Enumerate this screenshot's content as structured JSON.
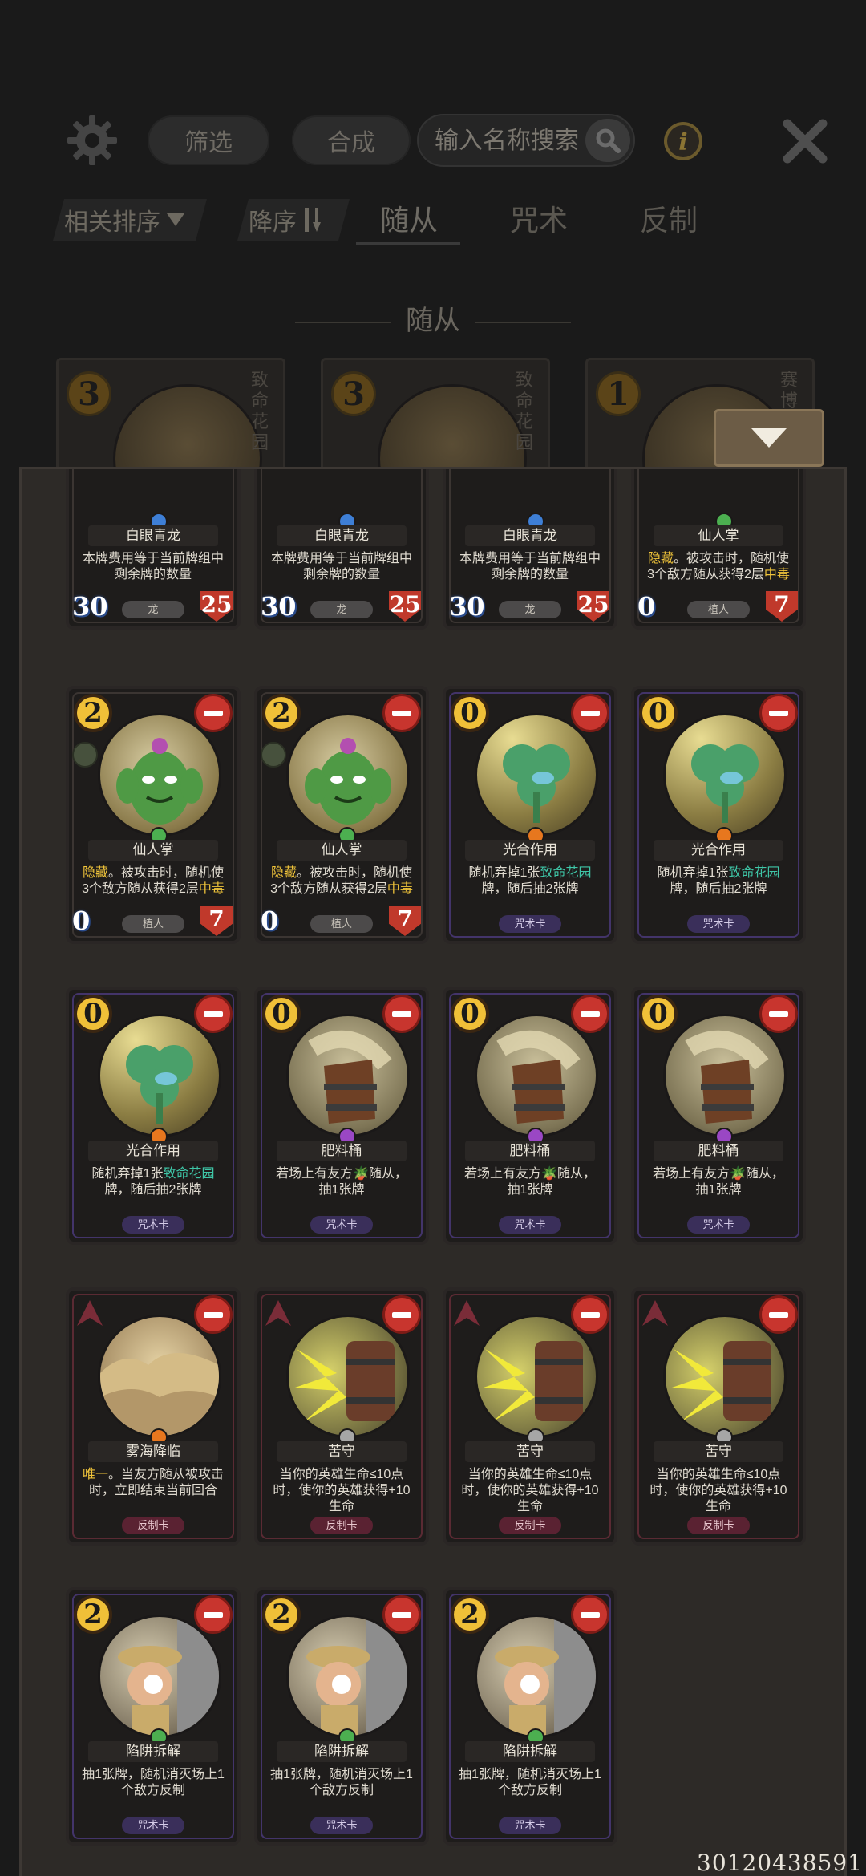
{
  "toolbar": {
    "filter_label": "筛选",
    "compose_label": "合成",
    "search_placeholder": "输入名称搜索"
  },
  "sortbar": {
    "relevance_label": "相关排序",
    "descending_label": "降序",
    "tabs": [
      {
        "label": "随从",
        "active": true
      },
      {
        "label": "咒术",
        "active": false
      },
      {
        "label": "反制",
        "active": false
      }
    ]
  },
  "section_title": "随从",
  "background_cards": [
    {
      "cost": "3",
      "tag": "致命花园"
    },
    {
      "cost": "3",
      "tag": "致命花园"
    },
    {
      "cost": "1",
      "tag": "赛博"
    }
  ],
  "cards": [
    {
      "name": "白眼青龙",
      "desc": [
        [
          "本牌费用等于当前牌组中剩余牌的数量",
          ""
        ]
      ],
      "atk": "30",
      "hp": "25",
      "tag": "龙",
      "gem": "blue",
      "type": "minion",
      "partial": true
    },
    {
      "name": "白眼青龙",
      "desc": [
        [
          "本牌费用等于当前牌组中剩余牌的数量",
          ""
        ]
      ],
      "atk": "30",
      "hp": "25",
      "tag": "龙",
      "gem": "blue",
      "type": "minion",
      "partial": true
    },
    {
      "name": "白眼青龙",
      "desc": [
        [
          "本牌费用等于当前牌组中剩余牌的数量",
          ""
        ]
      ],
      "atk": "30",
      "hp": "25",
      "tag": "龙",
      "gem": "blue",
      "type": "minion",
      "partial": true
    },
    {
      "name": "仙人掌",
      "desc": [
        [
          "隐藏",
          "kw"
        ],
        [
          "。被攻击时，随机使3个敌方随从获得2层",
          ""
        ],
        [
          "中毒",
          "kw"
        ]
      ],
      "atk": "0",
      "hp": "7",
      "tag": "植人",
      "gem": "green",
      "type": "minion",
      "partial": true
    },
    {
      "cost": "2",
      "name": "仙人掌",
      "desc": [
        [
          "隐藏",
          "kw"
        ],
        [
          "。被攻击时，随机使3个敌方随从获得2层",
          ""
        ],
        [
          "中毒",
          "kw"
        ]
      ],
      "atk": "0",
      "hp": "7",
      "tag": "植人",
      "gem": "green",
      "type": "minion",
      "art": "cactus"
    },
    {
      "cost": "2",
      "name": "仙人掌",
      "desc": [
        [
          "隐藏",
          "kw"
        ],
        [
          "。被攻击时，随机使3个敌方随从获得2层",
          ""
        ],
        [
          "中毒",
          "kw"
        ]
      ],
      "atk": "0",
      "hp": "7",
      "tag": "植人",
      "gem": "green",
      "type": "minion",
      "art": "cactus"
    },
    {
      "cost": "0",
      "name": "光合作用",
      "desc": [
        [
          "随机弃掉1张",
          ""
        ],
        [
          "致命花园",
          "kw-green"
        ],
        [
          "牌，随后抽2张牌",
          ""
        ]
      ],
      "tag": "咒术卡",
      "gem": "orange",
      "type": "spell",
      "art": "clover"
    },
    {
      "cost": "0",
      "name": "光合作用",
      "desc": [
        [
          "随机弃掉1张",
          ""
        ],
        [
          "致命花园",
          "kw-green"
        ],
        [
          "牌，随后抽2张牌",
          ""
        ]
      ],
      "tag": "咒术卡",
      "gem": "orange",
      "type": "spell",
      "art": "clover"
    },
    {
      "cost": "0",
      "name": "光合作用",
      "desc": [
        [
          "随机弃掉1张",
          ""
        ],
        [
          "致命花园",
          "kw-green"
        ],
        [
          "牌，随后抽2张牌",
          ""
        ]
      ],
      "tag": "咒术卡",
      "gem": "orange",
      "type": "spell",
      "art": "clover"
    },
    {
      "cost": "0",
      "name": "肥料桶",
      "desc": [
        [
          "若场上有友方",
          ""
        ],
        [
          "🪴",
          ""
        ],
        [
          "随从，抽1张牌",
          ""
        ]
      ],
      "tag": "咒术卡",
      "gem": "purple",
      "type": "spell",
      "art": "bucket"
    },
    {
      "cost": "0",
      "name": "肥料桶",
      "desc": [
        [
          "若场上有友方",
          ""
        ],
        [
          "🪴",
          ""
        ],
        [
          "随从，抽1张牌",
          ""
        ]
      ],
      "tag": "咒术卡",
      "gem": "purple",
      "type": "spell",
      "art": "bucket"
    },
    {
      "cost": "0",
      "name": "肥料桶",
      "desc": [
        [
          "若场上有友方",
          ""
        ],
        [
          "🪴",
          ""
        ],
        [
          "随从，抽1张牌",
          ""
        ]
      ],
      "tag": "咒术卡",
      "gem": "purple",
      "type": "spell",
      "art": "bucket"
    },
    {
      "name": "雾海降临",
      "desc": [
        [
          "唯一",
          "kw"
        ],
        [
          "。当友方随从被攻击时，立即结束当前回合",
          ""
        ]
      ],
      "tag": "反制卡",
      "gem": "orange",
      "type": "counter",
      "art": "mist"
    },
    {
      "name": "苦守",
      "desc": [
        [
          "当你的英雄生命≤10点时，使你的英雄获得+10生命",
          ""
        ]
      ],
      "tag": "反制卡",
      "gem": "gray",
      "type": "counter",
      "art": "shield"
    },
    {
      "name": "苦守",
      "desc": [
        [
          "当你的英雄生命≤10点时，使你的英雄获得+10生命",
          ""
        ]
      ],
      "tag": "反制卡",
      "gem": "gray",
      "type": "counter",
      "art": "shield"
    },
    {
      "name": "苦守",
      "desc": [
        [
          "当你的英雄生命≤10点时，使你的英雄获得+10生命",
          ""
        ]
      ],
      "tag": "反制卡",
      "gem": "gray",
      "type": "counter",
      "art": "shield"
    },
    {
      "cost": "2",
      "name": "陷阱拆解",
      "desc": [
        [
          "抽1张牌，随机消灭场上1个敌方反制",
          ""
        ]
      ],
      "tag": "咒术卡",
      "gem": "green",
      "type": "spell",
      "art": "trap"
    },
    {
      "cost": "2",
      "name": "陷阱拆解",
      "desc": [
        [
          "抽1张牌，随机消灭场上1个敌方反制",
          ""
        ]
      ],
      "tag": "咒术卡",
      "gem": "green",
      "type": "spell",
      "art": "trap"
    },
    {
      "cost": "2",
      "name": "陷阱拆解",
      "desc": [
        [
          "抽1张牌，随机消灭场上1个敌方反制",
          ""
        ]
      ],
      "tag": "咒术卡",
      "gem": "green",
      "type": "spell",
      "art": "trap"
    }
  ],
  "player_uid": "30120438591"
}
